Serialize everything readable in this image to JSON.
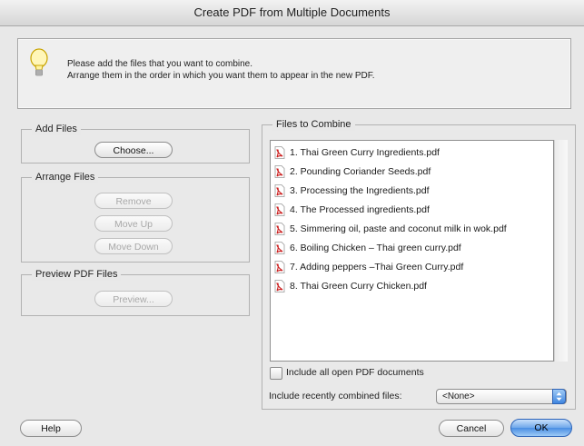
{
  "window": {
    "title": "Create PDF from Multiple Documents"
  },
  "info": {
    "line1": "Please add the files that you want to combine.",
    "line2": "Arrange them in the order in which you want them to appear in the new PDF."
  },
  "add_files": {
    "legend": "Add Files",
    "choose_label": "Choose..."
  },
  "arrange_files": {
    "legend": "Arrange Files",
    "remove_label": "Remove",
    "move_up_label": "Move Up",
    "move_down_label": "Move Down"
  },
  "preview_files": {
    "legend": "Preview PDF Files",
    "preview_label": "Preview..."
  },
  "files_to_combine": {
    "legend": "Files to Combine",
    "files": [
      "1. Thai Green Curry Ingredients.pdf",
      "2. Pounding Coriander Seeds.pdf",
      "3. Processing the Ingredients.pdf",
      "4. The Processed ingredients.pdf",
      "5. Simmering oil, paste and coconut milk in wok.pdf",
      "6. Boiling Chicken – Thai green curry.pdf",
      "7. Adding peppers –Thai Green Curry.pdf",
      "8. Thai Green Curry Chicken.pdf"
    ]
  },
  "options": {
    "include_open_label": "Include all open PDF documents",
    "include_open_checked": false,
    "recent_label": "Include recently combined files:",
    "recent_value": "<None>"
  },
  "footer": {
    "help_label": "Help",
    "cancel_label": "Cancel",
    "ok_label": "OK"
  },
  "icons": {
    "info": "lightbulb-icon",
    "file": "pdf-file-icon",
    "select": "up-down-arrows-icon"
  },
  "colors": {
    "accent": "#4a8ee3",
    "pdf_red": "#cc2020"
  }
}
